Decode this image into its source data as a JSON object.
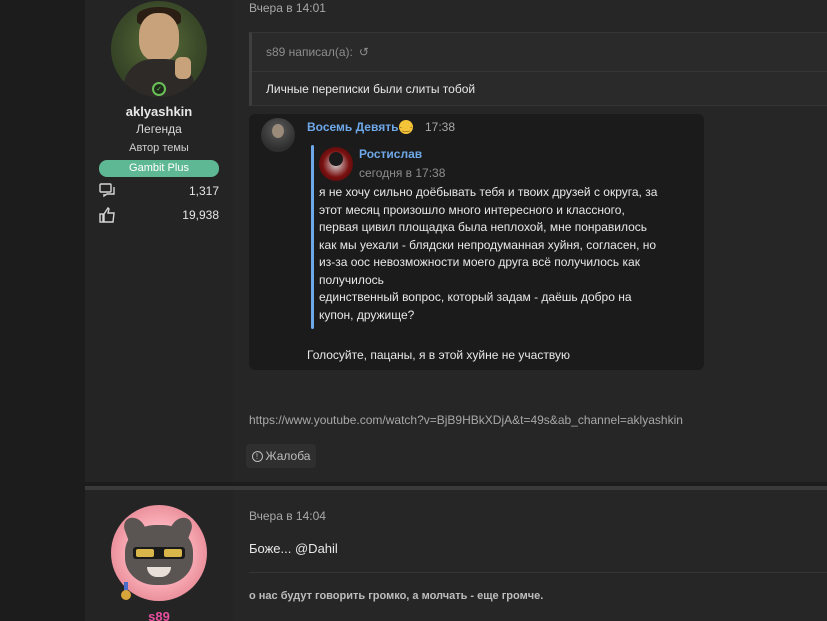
{
  "post1": {
    "user": {
      "name": "aklyashkin",
      "rank": "Легенда",
      "author_tag": "Автор темы",
      "badge": "Gambit Plus",
      "messages_count": "1,317",
      "likes_count": "19,938"
    },
    "date": "Вчера в 14:01",
    "quote": {
      "header": "s89 написал(а):",
      "text": "Личные переписки были слиты тобой"
    },
    "telegram": {
      "sender": "Восемь Девять",
      "sender_emoji": "😔",
      "time": "17:38",
      "reply_name": "Ростислав",
      "reply_time": "сегодня в 17:38",
      "reply_text": "я не хочу сильно доёбывать тебя и твоих друзей с округа, за\nэтот месяц произошло много интересного и классного,\nпервая цивил площадка была неплохой, мне понравилось\nкак мы уехали - блядски непродуманная хуйня, согласен, но\nиз-за оос невозможности моего друга всё получилось как\nполучилось\nединственный вопрос, который задам - даёшь добро на\nкупон, дружище?",
      "message": "Голосуйте, пацаны, я в этой хуйне не участвую"
    },
    "link": "https://www.youtube.com/watch?v=BjB9HBkXDjA&t=49s&ab_channel=aklyashkin",
    "report_label": "Жалоба"
  },
  "post2": {
    "user": {
      "name": "s89"
    },
    "date": "Вчера в 14:04",
    "text": "Боже... @Dahil",
    "signature": "о нас будут говорить громко, а молчать - еще громче."
  },
  "colors": {
    "accent_blue": "#6ea8e8",
    "badge_green": "#5fb894",
    "username_pink": "#e84fa0"
  }
}
